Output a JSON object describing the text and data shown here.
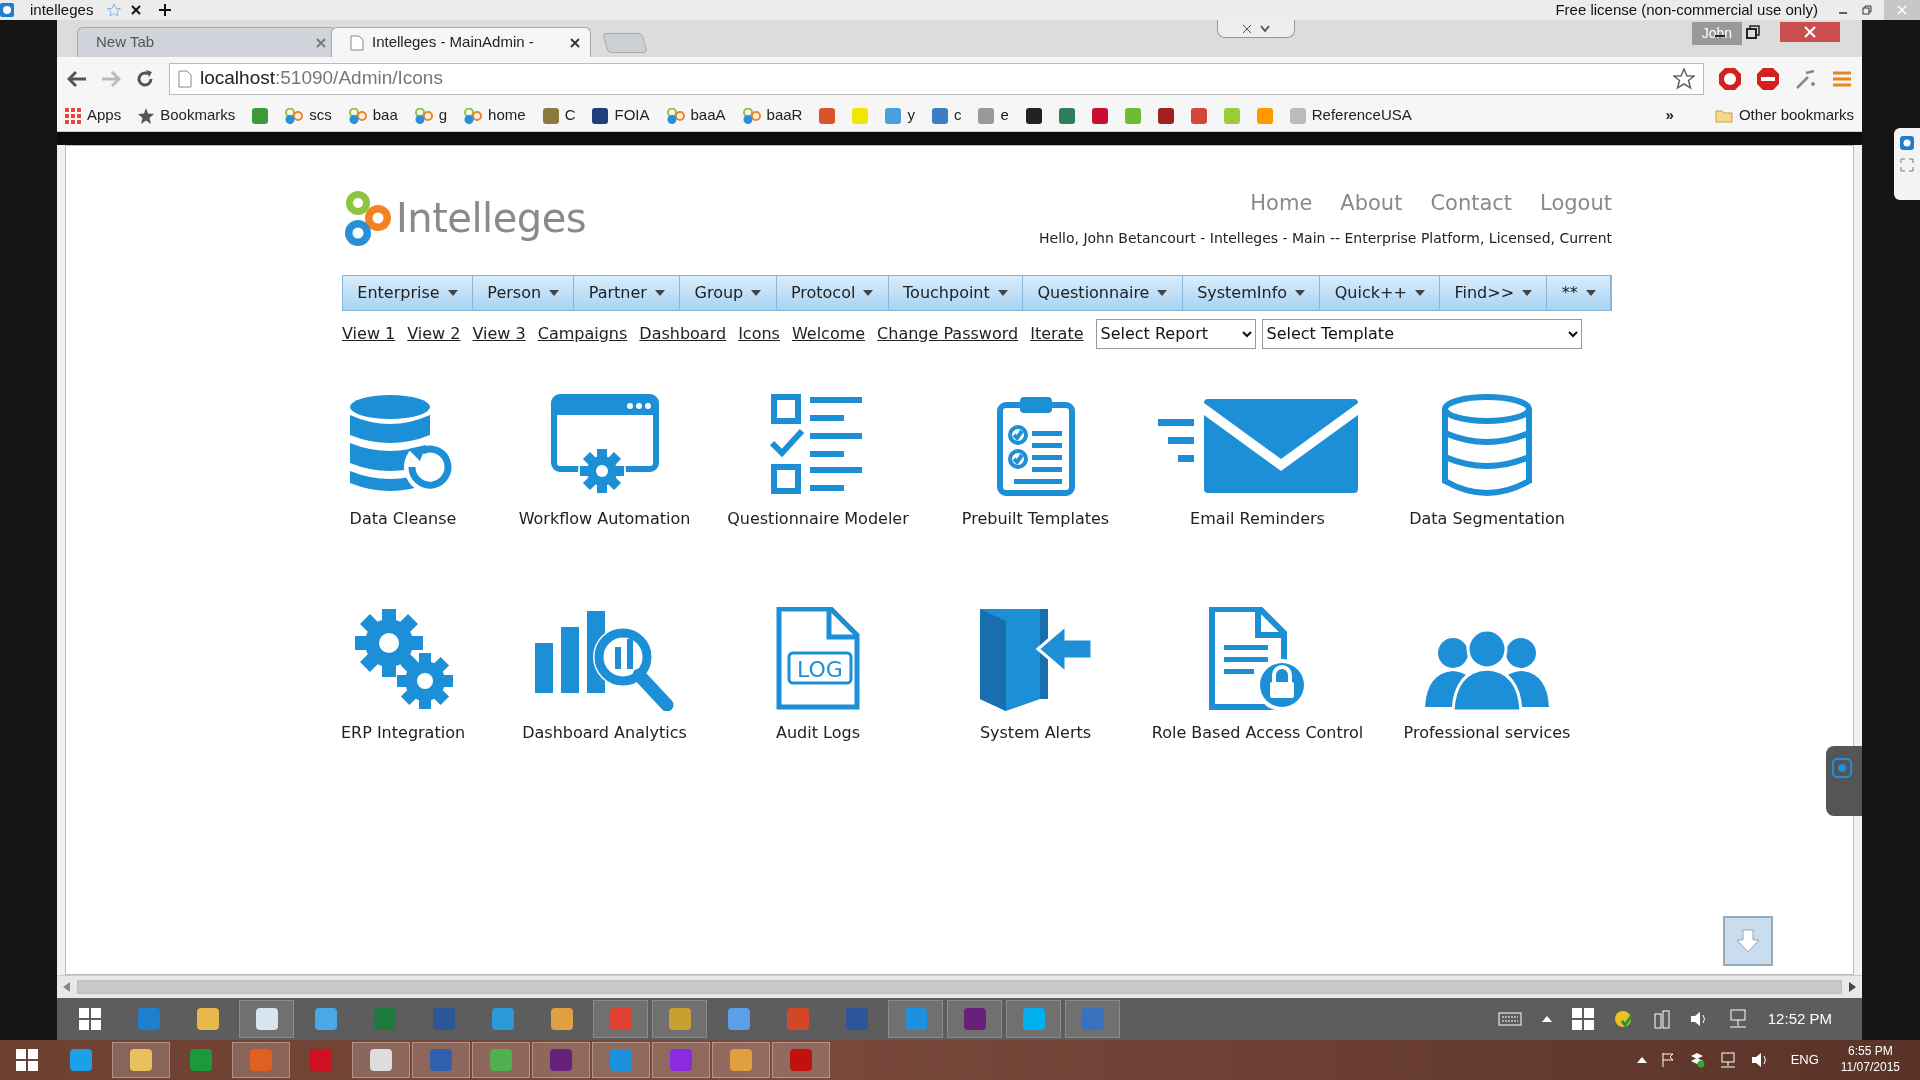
{
  "host_window": {
    "title": "intelleges",
    "license": "Free license (non-commercial use only)"
  },
  "browser": {
    "tabs": [
      {
        "label": "New Tab",
        "selected": false
      },
      {
        "label": "Intelleges - MainAdmin -",
        "selected": true
      }
    ],
    "user": "John",
    "address": {
      "host": "localhost",
      "path": ":51090/Admin/Icons"
    },
    "bookmarks": [
      {
        "kind": "grid",
        "label": "Apps",
        "color": "#e8453c"
      },
      {
        "kind": "star",
        "label": "Bookmarks",
        "color": "#555555"
      },
      {
        "kind": "square",
        "color": "#3c9a3c"
      },
      {
        "kind": "logo",
        "label": "scs",
        "color": "#2a8fd8"
      },
      {
        "kind": "logo",
        "label": "baa",
        "color": "#2a8fd8"
      },
      {
        "kind": "logo",
        "label": "g",
        "color": "#2a8fd8"
      },
      {
        "kind": "logo",
        "label": "home",
        "color": "#2a8fd8"
      },
      {
        "kind": "square",
        "label": "C",
        "color": "#8a7a40"
      },
      {
        "kind": "square",
        "label": "FOIA",
        "color": "#1d3f7a"
      },
      {
        "kind": "logo",
        "label": "baaA",
        "color": "#2a8fd8"
      },
      {
        "kind": "logo",
        "label": "baaR",
        "color": "#2a8fd8"
      },
      {
        "kind": "square",
        "color": "#d9542b"
      },
      {
        "kind": "square",
        "color": "#f2e600"
      },
      {
        "kind": "square",
        "label": "y",
        "color": "#4aa0d8"
      },
      {
        "kind": "square",
        "label": "c",
        "color": "#3a7dc0"
      },
      {
        "kind": "square",
        "label": "e",
        "color": "#999999"
      },
      {
        "kind": "square",
        "color": "#222222"
      },
      {
        "kind": "square",
        "color": "#2f7d5a"
      },
      {
        "kind": "square",
        "color": "#c8102e"
      },
      {
        "kind": "square",
        "color": "#6dbb2f"
      },
      {
        "kind": "square",
        "color": "#a02020"
      },
      {
        "kind": "square",
        "color": "#d44638"
      },
      {
        "kind": "square",
        "color": "#9ccc3a"
      },
      {
        "kind": "square",
        "color": "#ff9900"
      },
      {
        "kind": "square",
        "label": "ReferenceUSA",
        "color": "#bbbbbb"
      }
    ],
    "overflow": "»",
    "other_bookmarks": "Other bookmarks"
  },
  "page": {
    "logo": "Intelleges",
    "top_nav": [
      "Home",
      "About",
      "Contact",
      "Logout"
    ],
    "greeting": "Hello, John Betancourt - Intelleges - Main -- Enterprise Platform, Licensed, Current",
    "menu": [
      "Enterprise",
      "Person",
      "Partner",
      "Group",
      "Protocol",
      "Touchpoint",
      "Questionnaire",
      "SystemInfo",
      "Quick++",
      "Find>>",
      "**"
    ],
    "links": [
      "View 1",
      "View 2",
      "View 3",
      "Campaigns",
      "Dashboard",
      "Icons",
      "Welcome",
      "Change Password",
      "Iterate"
    ],
    "selects": [
      {
        "value": "Select Report"
      },
      {
        "value": "Select Template"
      }
    ],
    "features": [
      {
        "label": "Data Cleanse"
      },
      {
        "label": "Workflow Automation"
      },
      {
        "label": "Questionnaire Modeler"
      },
      {
        "label": "Prebuilt Templates"
      },
      {
        "label": "Email Reminders"
      },
      {
        "label": "Data Segmentation"
      },
      {
        "label": "ERP Integration"
      },
      {
        "label": "Dashboard Analytics"
      },
      {
        "label": "Audit Logs",
        "icon_text": "LOG"
      },
      {
        "label": "System Alerts"
      },
      {
        "label": "Role Based Access Control"
      },
      {
        "label": "Professional services"
      }
    ]
  },
  "inner_taskbar": {
    "apps": [
      {
        "color": "#1e7fd0",
        "selected": false
      },
      {
        "color": "#e8b84a",
        "selected": false
      },
      {
        "color": "#d8e4f0",
        "selected": true
      },
      {
        "color": "#4aa8e8",
        "selected": false
      },
      {
        "color": "#1f7a40",
        "selected": false
      },
      {
        "color": "#2b579a",
        "selected": false
      },
      {
        "color": "#2a9ad8",
        "selected": false
      },
      {
        "color": "#e0a040",
        "selected": false
      },
      {
        "color": "#e04030",
        "selected": true
      },
      {
        "color": "#c8a030",
        "selected": true
      },
      {
        "color": "#5aa0e8",
        "selected": false
      },
      {
        "color": "#d24726",
        "selected": false
      },
      {
        "color": "#2b579a",
        "selected": false
      },
      {
        "color": "#1e90e0",
        "selected": true
      },
      {
        "color": "#68217a",
        "selected": true
      },
      {
        "color": "#00aff0",
        "selected": true
      },
      {
        "color": "#3a70c0",
        "selected": true
      }
    ],
    "time": "12:52 PM"
  },
  "taskbar": {
    "apps": [
      {
        "color": "#1ea0e8",
        "selected": false
      },
      {
        "color": "#e8c060",
        "selected": true
      },
      {
        "color": "#1a9a3a",
        "selected": false
      },
      {
        "color": "#e06020",
        "selected": true
      },
      {
        "color": "#d01020",
        "selected": false
      },
      {
        "color": "#dddddd",
        "selected": true
      },
      {
        "color": "#3060b0",
        "selected": true
      },
      {
        "color": "#50b050",
        "selected": true
      },
      {
        "color": "#68217a",
        "selected": true
      },
      {
        "color": "#1e90e0",
        "selected": true
      },
      {
        "color": "#8a2be2",
        "selected": true
      },
      {
        "color": "#e0a040",
        "selected": true
      },
      {
        "color": "#c01010",
        "selected": true
      }
    ],
    "language": "ENG",
    "time": "6:55 PM",
    "date": "11/07/2015"
  }
}
